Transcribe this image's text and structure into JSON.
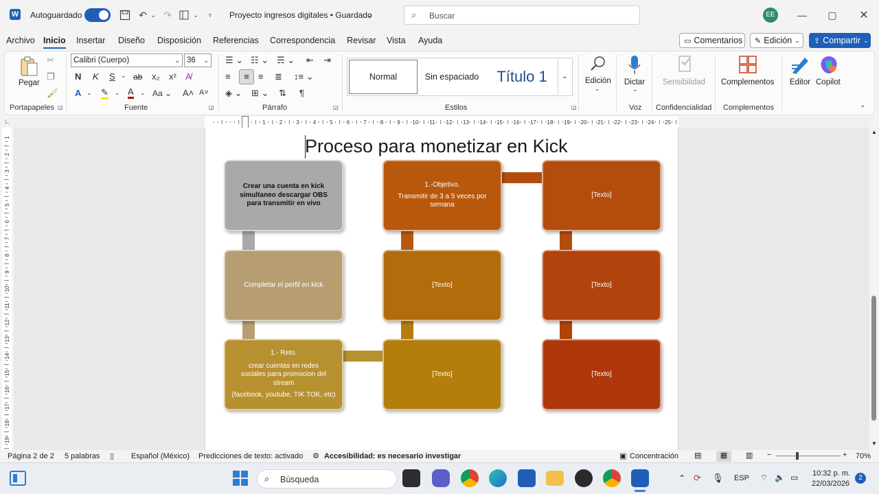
{
  "titlebar": {
    "autosave_label": "Autoguardado",
    "doc_title": "Proyecto ingresos digitales • Guardado",
    "search_placeholder": "Buscar",
    "user_initials": "EE"
  },
  "menu": {
    "items": [
      "Archivo",
      "Inicio",
      "Insertar",
      "Diseño",
      "Disposición",
      "Referencias",
      "Correspondencia",
      "Revisar",
      "Vista",
      "Ayuda"
    ],
    "active": "Inicio",
    "comments_label": "Comentarios",
    "editing_label": "Edición",
    "share_label": "Compartir"
  },
  "ribbon": {
    "paste_label": "Pegar",
    "font_name": "Calibri (Cuerpo)",
    "font_size": "36",
    "bold": "N",
    "italic": "K",
    "underline": "S",
    "strike": "ab",
    "styles": {
      "normal": "Normal",
      "no_spacing": "Sin espaciado",
      "heading1": "Título 1"
    },
    "editing": "Edición",
    "dictate": "Dictar",
    "sensitivity": "Sensibilidad",
    "addins": "Complementos",
    "editor": "Editor",
    "copilot": "Copilot",
    "groups": [
      "Portapapeles",
      "Fuente",
      "Párrafo",
      "Estilos",
      "Voz",
      "Confidencialidad",
      "Complementos"
    ]
  },
  "document": {
    "title": "Proceso para monetizar en Kick",
    "boxes": [
      {
        "text": "Crear una cuenta en kick simultaneo descargar OBS para transmitir en vivo",
        "color": "#a9a9a9",
        "dark": true
      },
      {
        "text": "1.-Objetivo.",
        "text2": "Transmitir de 3 a 5 veces por semana",
        "color": "#b8580d"
      },
      {
        "text": "[Texto]",
        "color": "#b24d0e"
      },
      {
        "text": "Completar el perfil en kick",
        "color": "#b79e72"
      },
      {
        "text": "[Texto]",
        "color": "#b26c0c"
      },
      {
        "text": "[Texto]",
        "color": "#b2430d"
      },
      {
        "text": "1.- Reto.",
        "text2": "crear cuentas en redes sociales para promocion del stream",
        "text3": "(facebook, youtube, TIK TOK, etc)",
        "color": "#b7902f"
      },
      {
        "text": "[Texto]",
        "color": "#b37e0c"
      },
      {
        "text": "[Texto]",
        "color": "#ae370c"
      }
    ]
  },
  "status": {
    "page": "Página 2 de 2",
    "words": "5 palabras",
    "language": "Español (México)",
    "predictions": "Predicciones de texto: activado",
    "accessibility": "Accesibilidad: es necesario investigar",
    "focus": "Concentración",
    "zoom": "70%"
  },
  "taskbar": {
    "search_label": "Búsqueda",
    "lang": "ESP",
    "time": "10:32 p. m.",
    "date": "22/03/2026",
    "notif_count": "2"
  }
}
